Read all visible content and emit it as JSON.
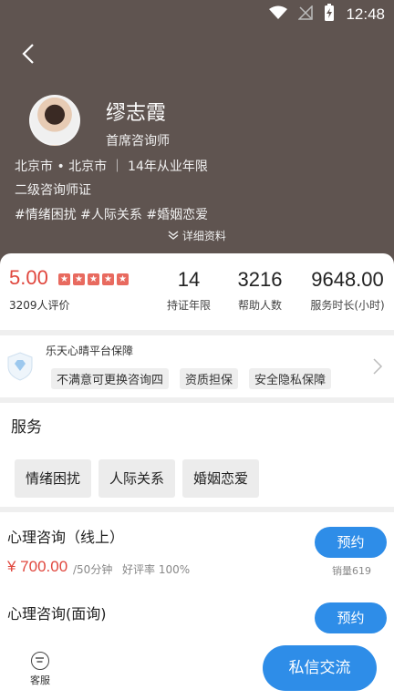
{
  "status_bar": {
    "time": "12:48",
    "icons": [
      "wifi-icon",
      "signal-icon",
      "battery-charging-icon"
    ]
  },
  "profile": {
    "name": "缪志霞",
    "title": "首席咨询师",
    "location_experience": "北京市 • 北京市 ｜ 14年从业年限",
    "certificate": "二级咨询师证",
    "topics": "#情绪困扰  #人际关系  #婚姻恋爱",
    "detail_link": "详细资料"
  },
  "stats": {
    "rating": "5.00",
    "rating_count": "3209人评价",
    "items": [
      {
        "value": "14",
        "label": "持证年限"
      },
      {
        "value": "3216",
        "label": "帮助人数"
      },
      {
        "value": "9648.00",
        "label": "服务时长(小时)"
      }
    ]
  },
  "guarantee": {
    "title": "乐天心晴平台保障",
    "tags": [
      "不满意可更换咨询四",
      "资质担保",
      "安全隐私保障"
    ]
  },
  "services": {
    "heading": "服务",
    "tags": [
      "情绪困扰",
      "人际关系",
      "婚姻恋爱"
    ]
  },
  "offers": [
    {
      "name": "心理咨询（线上）",
      "price": "¥ 700.00",
      "per": "/50分钟",
      "praise": "好评率 100%",
      "button": "预约",
      "sales": "销量619"
    },
    {
      "name": "心理咨询(面询)",
      "button": "预约"
    }
  ],
  "bottom": {
    "customer_service": "客服",
    "chat_button": "私信交流"
  },
  "colors": {
    "header_bg": "#5f5450",
    "accent_red": "#e0473e",
    "primary_blue": "#2e8de8"
  }
}
